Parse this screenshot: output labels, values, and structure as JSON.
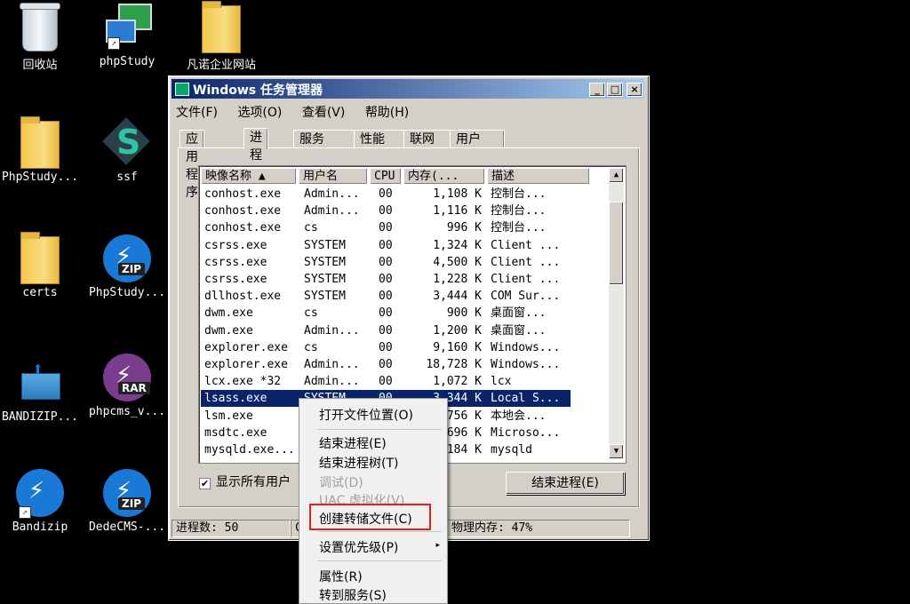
{
  "desktop": {
    "icons": [
      {
        "label": "回收站",
        "icon": "recycle-bin-icon"
      },
      {
        "label": "phpStudy",
        "icon": "phpstudy-icon"
      },
      {
        "label": "凡诺企业网站",
        "icon": "folder-icon"
      },
      {
        "label": "PhpStudy...",
        "icon": "folder-icon"
      },
      {
        "label": "ssf",
        "icon": "ssf-icon"
      },
      {
        "label": "certs",
        "icon": "folder-icon"
      },
      {
        "label": "PhpStudy...",
        "icon": "zip-archive-icon"
      },
      {
        "label": "BANDIZIP...",
        "icon": "bandizip-installer-icon"
      },
      {
        "label": "phpcms_v...",
        "icon": "rar-archive-icon"
      },
      {
        "label": "Bandizip",
        "icon": "bandizip-icon"
      },
      {
        "label": "DedeCMS-...",
        "icon": "zip-archive-icon"
      }
    ],
    "zip_tag": "ZIP",
    "rar_tag": "RAR"
  },
  "window": {
    "title": "Windows 任务管理器",
    "controls": {
      "minimize": "_",
      "maximize": "□",
      "close": "×"
    },
    "menu": [
      "文件(F)",
      "选项(O)",
      "查看(V)",
      "帮助(H)"
    ],
    "tabs": [
      "应用程序",
      "进程",
      "服务",
      "性能",
      "联网",
      "用户"
    ],
    "active_tab": "进程",
    "columns": [
      "映像名称 ▲",
      "用户名",
      "CPU",
      "内存(...",
      "描述"
    ],
    "rows": [
      {
        "name": "conhost.exe",
        "user": "Admin...",
        "cpu": "00",
        "mem": "1,108 K",
        "desc": "控制台..."
      },
      {
        "name": "conhost.exe",
        "user": "Admin...",
        "cpu": "00",
        "mem": "1,116 K",
        "desc": "控制台..."
      },
      {
        "name": "conhost.exe",
        "user": "cs",
        "cpu": "00",
        "mem": "996 K",
        "desc": "控制台..."
      },
      {
        "name": "csrss.exe",
        "user": "SYSTEM",
        "cpu": "00",
        "mem": "1,324 K",
        "desc": "Client ..."
      },
      {
        "name": "csrss.exe",
        "user": "SYSTEM",
        "cpu": "00",
        "mem": "4,500 K",
        "desc": "Client ..."
      },
      {
        "name": "csrss.exe",
        "user": "SYSTEM",
        "cpu": "00",
        "mem": "1,228 K",
        "desc": "Client ..."
      },
      {
        "name": "dllhost.exe",
        "user": "SYSTEM",
        "cpu": "00",
        "mem": "3,444 K",
        "desc": "COM Sur..."
      },
      {
        "name": "dwm.exe",
        "user": "cs",
        "cpu": "00",
        "mem": "900 K",
        "desc": "桌面窗..."
      },
      {
        "name": "dwm.exe",
        "user": "Admin...",
        "cpu": "00",
        "mem": "1,200 K",
        "desc": "桌面窗..."
      },
      {
        "name": "explorer.exe",
        "user": "cs",
        "cpu": "00",
        "mem": "9,160 K",
        "desc": "Windows..."
      },
      {
        "name": "explorer.exe",
        "user": "Admin...",
        "cpu": "00",
        "mem": "18,728 K",
        "desc": "Windows..."
      },
      {
        "name": "lcx.exe *32",
        "user": "Admin...",
        "cpu": "00",
        "mem": "1,072 K",
        "desc": "lcx"
      },
      {
        "name": "lsass.exe",
        "user": "SYSTEM",
        "cpu": "00",
        "mem": "3,344 K",
        "desc": "Local S..."
      },
      {
        "name": "lsm.exe",
        "user": "",
        "cpu": "",
        "mem": "756 K",
        "desc": "本地会..."
      },
      {
        "name": "msdtc.exe",
        "user": "",
        "cpu": "",
        "mem": "696 K",
        "desc": "Microso..."
      },
      {
        "name": "mysqld.exe...",
        "user": "",
        "cpu": "",
        "mem": "184 K",
        "desc": "mysqld"
      }
    ],
    "selected_row": 12,
    "show_all_label": "显示所有用户",
    "show_all_checked": "✔",
    "end_process_button": "结束进程(E)",
    "status_processes": "进程数: 50",
    "status_cpu": "C",
    "status_memory": "物理内存: 47%"
  },
  "context_menu": {
    "items": [
      {
        "label": "打开文件位置(O)",
        "disabled": false
      },
      {
        "label": "结束进程(E)",
        "disabled": false
      },
      {
        "label": "结束进程树(T)",
        "disabled": false
      },
      {
        "label": "调试(D)",
        "disabled": true
      },
      {
        "label": "UAC 虚拟化(V)",
        "disabled": true
      },
      {
        "label": "创建转储文件(C)",
        "disabled": false
      },
      {
        "label": "设置优先级(P)",
        "disabled": false,
        "submenu": "▸"
      },
      {
        "label": "属性(R)",
        "disabled": false
      },
      {
        "label": "转到服务(S)",
        "disabled": false
      }
    ],
    "highlight_color": "#e02020"
  }
}
